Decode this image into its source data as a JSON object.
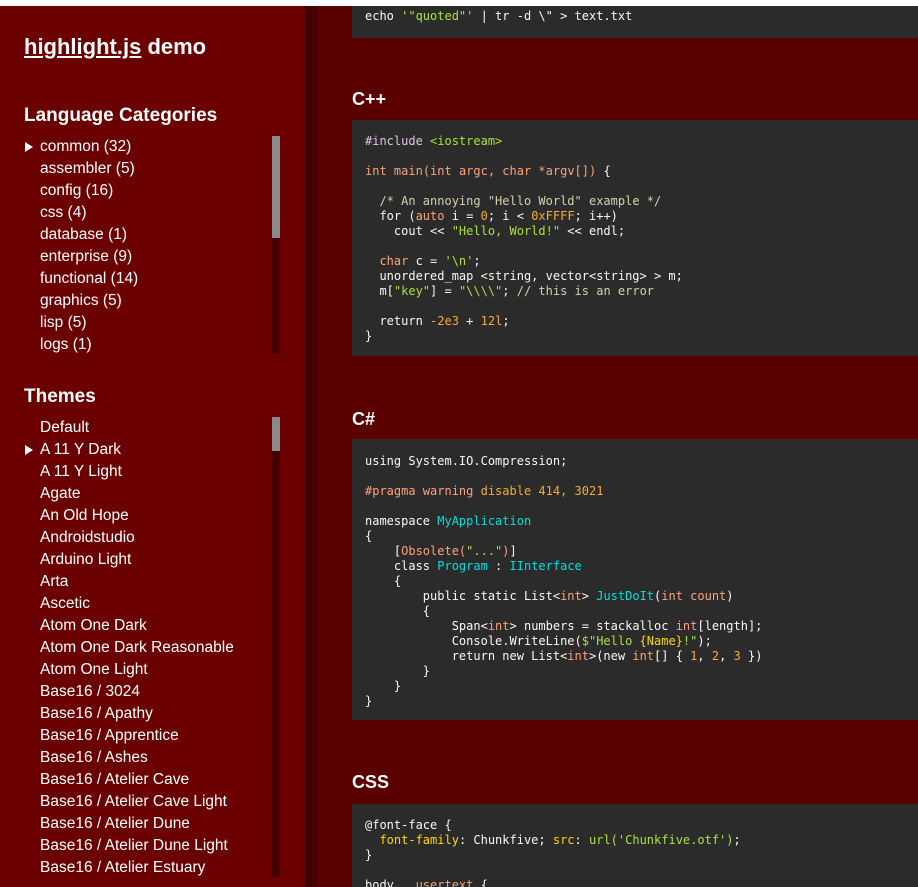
{
  "brand": {
    "link_text": "highlight.js",
    "suffix": " demo"
  },
  "categories": {
    "title": "Language Categories",
    "items": [
      {
        "label": "common (32)",
        "selected": true
      },
      {
        "label": "assembler (5)"
      },
      {
        "label": "config (16)"
      },
      {
        "label": "css (4)"
      },
      {
        "label": "database (1)"
      },
      {
        "label": "enterprise (9)"
      },
      {
        "label": "functional (14)"
      },
      {
        "label": "graphics (5)"
      },
      {
        "label": "lisp (5)"
      },
      {
        "label": "logs (1)"
      }
    ]
  },
  "themes": {
    "title": "Themes",
    "items": [
      {
        "label": "Default"
      },
      {
        "label": "A 11 Y Dark",
        "selected": true
      },
      {
        "label": "A 11 Y Light"
      },
      {
        "label": "Agate"
      },
      {
        "label": "An Old Hope"
      },
      {
        "label": "Androidstudio"
      },
      {
        "label": "Arduino Light"
      },
      {
        "label": "Arta"
      },
      {
        "label": "Ascetic"
      },
      {
        "label": "Atom One Dark"
      },
      {
        "label": "Atom One Dark Reasonable"
      },
      {
        "label": "Atom One Light"
      },
      {
        "label": "Base16 / 3024"
      },
      {
        "label": "Base16 / Apathy"
      },
      {
        "label": "Base16 / Apprentice"
      },
      {
        "label": "Base16 / Ashes"
      },
      {
        "label": "Base16 / Atelier Cave"
      },
      {
        "label": "Base16 / Atelier Cave Light"
      },
      {
        "label": "Base16 / Atelier Dune"
      },
      {
        "label": "Base16 / Atelier Dune Light"
      },
      {
        "label": "Base16 / Atelier Estuary"
      }
    ]
  },
  "sections": {
    "cpp": {
      "title": "C++"
    },
    "csharp": {
      "title": "C#"
    },
    "css": {
      "title": "CSS"
    }
  },
  "colors": {
    "sidebar_bg": "#6b0000",
    "main_bg": "#5a0000",
    "code_bg": "#2b2b2b",
    "string": "#abe338",
    "keyword": "#ffa07a",
    "number": "#f5ab35",
    "title": "#00e0e0"
  }
}
